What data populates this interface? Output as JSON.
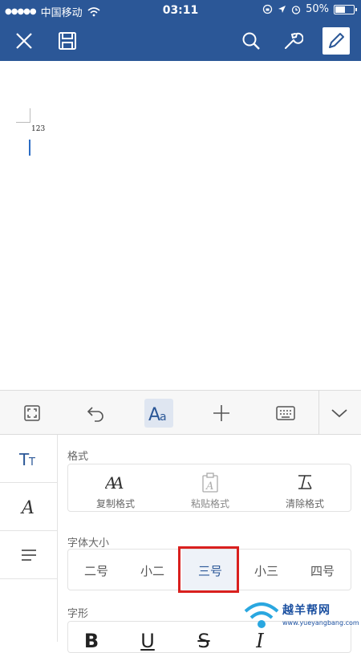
{
  "status_bar": {
    "carrier": "中国移动",
    "time": "03:11",
    "battery": "50%"
  },
  "toolbar": {
    "icons": [
      "close-icon",
      "save-icon",
      "search-icon",
      "wrench-icon",
      "edit-pencil-icon"
    ],
    "accent_color": "#2b5797"
  },
  "document": {
    "text": "123"
  },
  "ribbon": {
    "buttons": [
      "fullscreen-icon",
      "undo-icon",
      "text-format-icon",
      "insert-plus-icon",
      "keyboard-icon",
      "collapse-chevron-icon"
    ],
    "active": "text-format-icon"
  },
  "side_tabs": {
    "items": [
      {
        "icon": "font-size-tab-icon",
        "glyph": "Tт"
      },
      {
        "icon": "font-tab-icon",
        "glyph": "A"
      },
      {
        "icon": "paragraph-tab-icon"
      }
    ]
  },
  "format_section": {
    "label": "格式",
    "items": [
      {
        "label": "复制格式",
        "icon": "copy-format-icon"
      },
      {
        "label": "粘贴格式",
        "icon": "paste-format-icon",
        "disabled": true
      },
      {
        "label": "清除格式",
        "icon": "clear-format-icon"
      }
    ]
  },
  "font_size_section": {
    "label": "字体大小",
    "options": [
      "二号",
      "小二",
      "三号",
      "小三",
      "四号"
    ],
    "selected": "三号"
  },
  "font_style_section": {
    "label": "字形",
    "options": [
      "B",
      "U",
      "S",
      "I"
    ]
  },
  "watermark": {
    "text": "越羊帮网",
    "url": "www.yueyangbang.com"
  }
}
